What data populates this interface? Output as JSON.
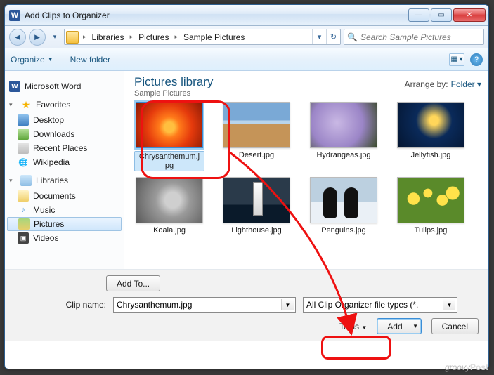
{
  "title": "Add Clips to Organizer",
  "breadcrumb": {
    "seg1": "Libraries",
    "seg2": "Pictures",
    "seg3": "Sample Pictures"
  },
  "search": {
    "placeholder": "Search Sample Pictures"
  },
  "toolbar": {
    "organize": "Organize",
    "newfolder": "New folder"
  },
  "sidebar": {
    "word": "Microsoft Word",
    "fav_head": "Favorites",
    "desktop": "Desktop",
    "downloads": "Downloads",
    "recent": "Recent Places",
    "wiki": "Wikipedia",
    "lib_head": "Libraries",
    "docs": "Documents",
    "music": "Music",
    "pics": "Pictures",
    "vids": "Videos"
  },
  "library": {
    "title": "Pictures library",
    "subtitle": "Sample Pictures",
    "arrange_lbl": "Arrange by:",
    "arrange_val": "Folder ▾"
  },
  "files": {
    "f0": "Chrysanthemum.jpg",
    "f1": "Desert.jpg",
    "f2": "Hydrangeas.jpg",
    "f3": "Jellyfish.jpg",
    "f4": "Koala.jpg",
    "f5": "Lighthouse.jpg",
    "f6": "Penguins.jpg",
    "f7": "Tulips.jpg"
  },
  "bottom": {
    "addto": "Add To...",
    "clipname_lbl": "Clip name:",
    "clipname_val": "Chrysanthemum.jpg",
    "filetype": "All Clip Organizer file types  (*.",
    "tools": "Tools",
    "add": "Add",
    "cancel": "Cancel"
  },
  "watermark_g": "groovy",
  "watermark_p": "Post"
}
